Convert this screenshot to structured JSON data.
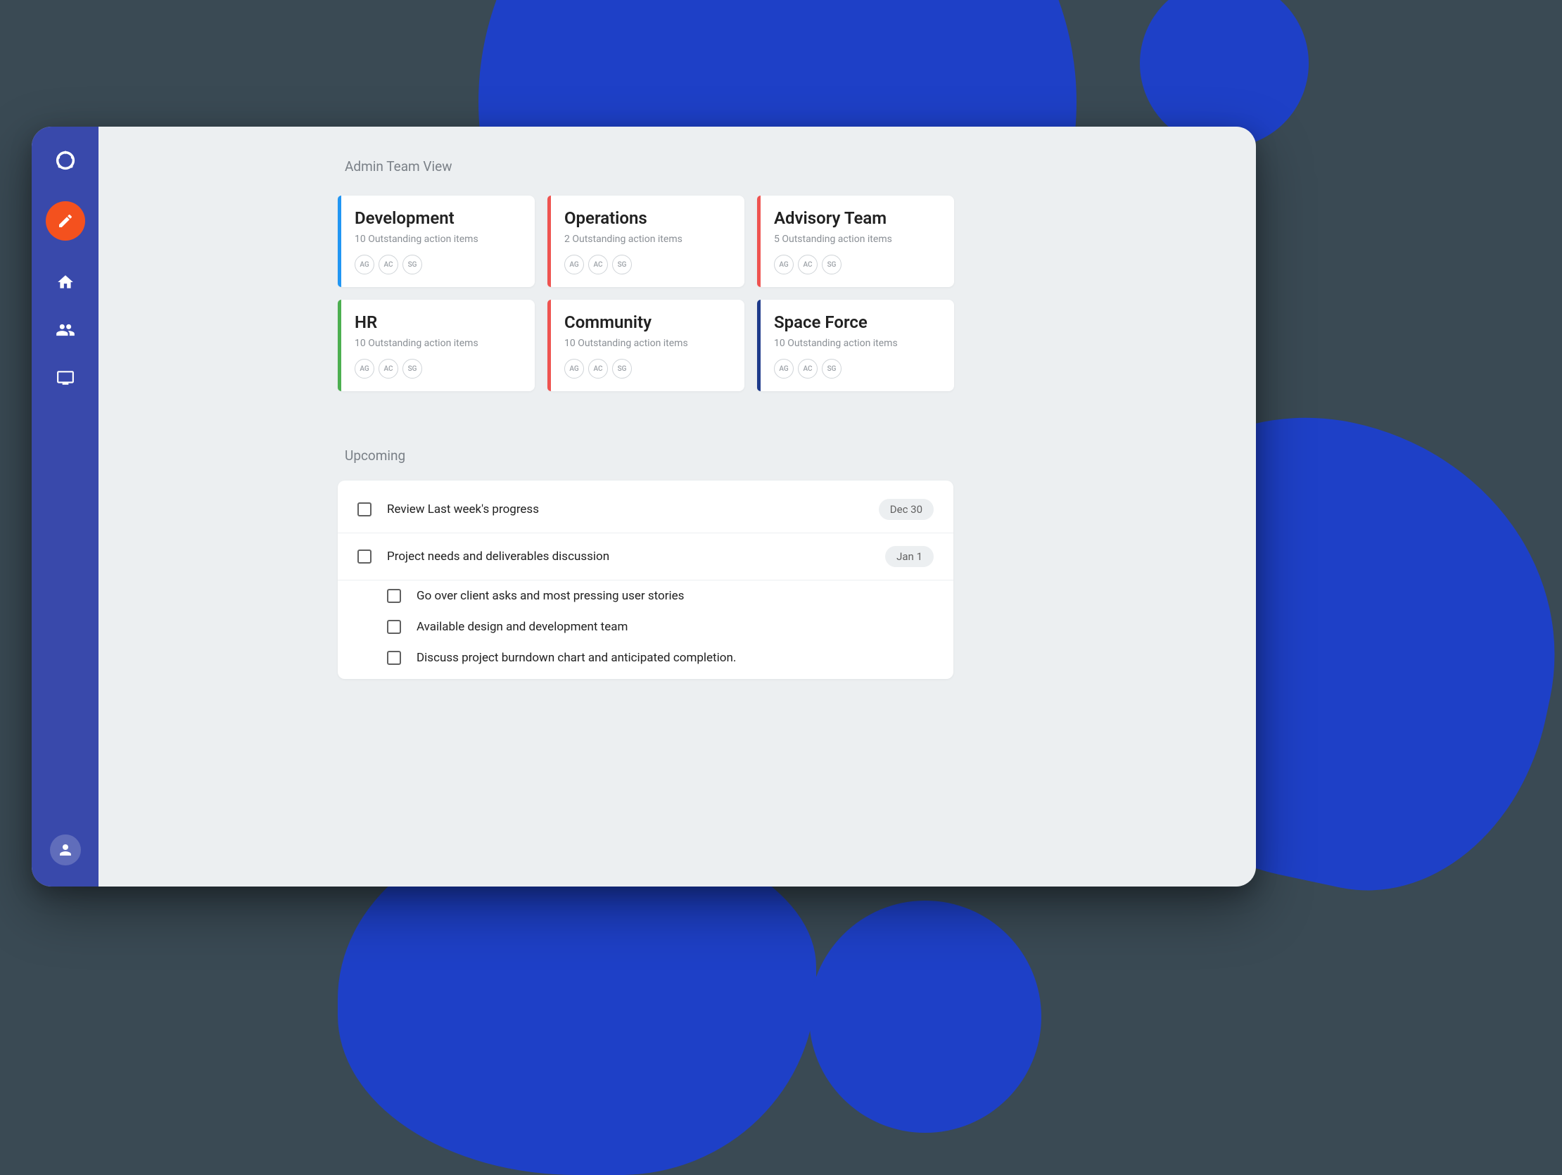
{
  "page_title": "Admin Team View",
  "teams": [
    {
      "name": "Development",
      "subtitle": "10 Outstanding action items",
      "color": "blue",
      "avatars": [
        "AG",
        "AC",
        "SG"
      ]
    },
    {
      "name": "Operations",
      "subtitle": "2 Outstanding action items",
      "color": "red",
      "avatars": [
        "AG",
        "AC",
        "SG"
      ]
    },
    {
      "name": "Advisory Team",
      "subtitle": "5 Outstanding action items",
      "color": "red",
      "avatars": [
        "AG",
        "AC",
        "SG"
      ]
    },
    {
      "name": "HR",
      "subtitle": "10 Outstanding action items",
      "color": "green",
      "avatars": [
        "AG",
        "AC",
        "SG"
      ]
    },
    {
      "name": "Community",
      "subtitle": "10 Outstanding action items",
      "color": "red",
      "avatars": [
        "AG",
        "AC",
        "SG"
      ]
    },
    {
      "name": "Space Force",
      "subtitle": "10 Outstanding action items",
      "color": "darkblue",
      "avatars": [
        "AG",
        "AC",
        "SG"
      ]
    }
  ],
  "upcoming_title": "Upcoming",
  "upcoming_items": [
    {
      "text": "Review Last week's progress",
      "date": "Dec 30",
      "sub": false
    },
    {
      "text": "Project needs and deliverables discussion",
      "date": "Jan 1",
      "sub": false
    },
    {
      "text": "Go over client asks and most pressing user stories",
      "date": "",
      "sub": true
    },
    {
      "text": "Available design and development team",
      "date": "",
      "sub": true
    },
    {
      "text": "Discuss project burndown chart and anticipated completion.",
      "date": "",
      "sub": true
    }
  ]
}
